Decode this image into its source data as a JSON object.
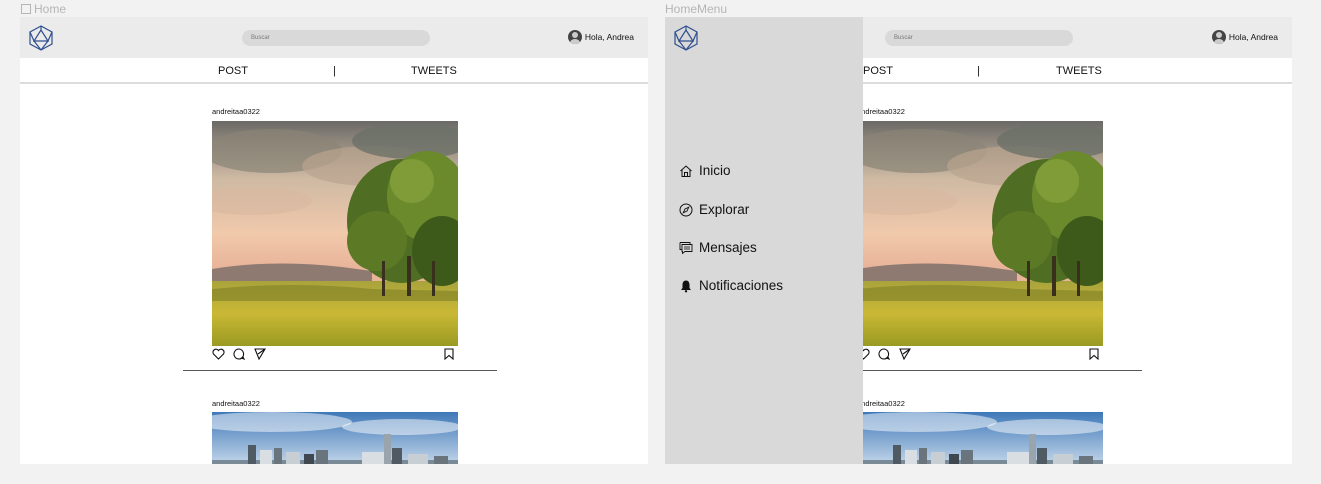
{
  "frames": [
    {
      "label": "Home"
    },
    {
      "label": "HomeMenu"
    }
  ],
  "header": {
    "search_placeholder": "Buscar",
    "greeting": "Hola, Andrea"
  },
  "tabs": {
    "post": "POST",
    "separator": "|",
    "tweets": "TWEETS"
  },
  "posts": [
    {
      "username": "andreitaa0322",
      "image": "landscape-photo"
    },
    {
      "username": "andreitaa0322",
      "image": "city-skyline-photo"
    }
  ],
  "menu": {
    "items": [
      {
        "label": "Inicio",
        "icon": "home-icon"
      },
      {
        "label": "Explorar",
        "icon": "compass-icon"
      },
      {
        "label": "Mensajes",
        "icon": "messages-icon"
      },
      {
        "label": "Notificaciones",
        "icon": "bell-icon"
      }
    ]
  },
  "colors": {
    "header_bg": "#ebebeb",
    "sidebar_bg": "#d9d9d9",
    "search_bg": "#d9d9d9",
    "logo_stroke": "#2f4f8f"
  }
}
